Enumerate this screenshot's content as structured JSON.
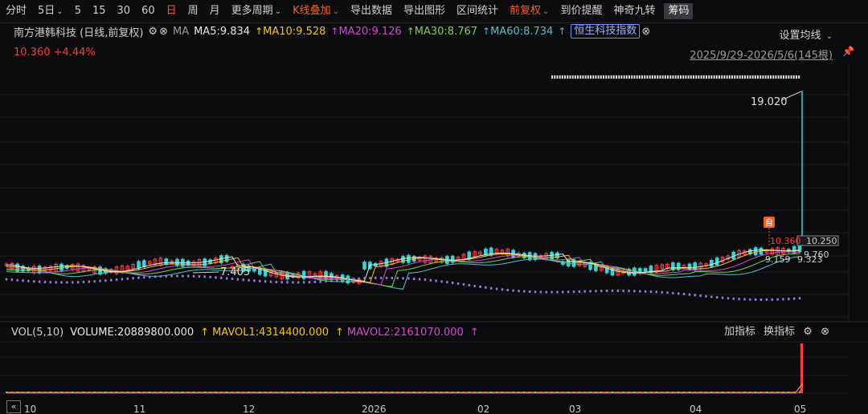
{
  "toolbar": {
    "items": [
      {
        "label": "分时"
      },
      {
        "label": "5日",
        "caret": true
      },
      {
        "label": "5"
      },
      {
        "label": "15"
      },
      {
        "label": "30"
      },
      {
        "label": "60"
      },
      {
        "label": "日",
        "active": true
      },
      {
        "label": "周"
      },
      {
        "label": "月"
      },
      {
        "label": "更多周期",
        "caret": true
      },
      {
        "label": "K线叠加",
        "active": true,
        "caret": true
      },
      {
        "label": "导出数据"
      },
      {
        "label": "导出图形"
      },
      {
        "label": "区间统计"
      },
      {
        "label": "前复权",
        "active": true,
        "caret": true
      },
      {
        "label": "到价提醒"
      },
      {
        "label": "神奇九转"
      },
      {
        "label": "筹码",
        "chip": true
      }
    ]
  },
  "info": {
    "title": "南方港韩科技 (日线,前复权)",
    "ma_label": "MA",
    "ma5": "MA5:9.834",
    "ma10": "MA10:9.528",
    "ma20": "MA20:9.126",
    "ma30": "MA30:8.767",
    "ma60": "MA60:8.734",
    "overlay_index": "恒生科技指数",
    "set_ma": "设置均线",
    "price_change": "10.360 +4.44%",
    "date_range": "2025/9/29-2026/5/6(145根)"
  },
  "colors": {
    "ma5": "#e6e6e6",
    "ma10": "#f5c518",
    "ma20": "#d14bd1",
    "ma30": "#7bd34a",
    "ma60": "#4fc3c8",
    "up": "#ff3a3a",
    "down": "#2fd6d6",
    "index": "#9a78e6",
    "accent": "#f0621e"
  },
  "chart_data": {
    "type": "candlestick",
    "price_annotations": [
      "19.020",
      "7.405"
    ],
    "right_labels": [
      "10.250",
      "10.360",
      "9.760",
      "9.323",
      "9.159"
    ],
    "x_labels": [
      "10",
      "11",
      "12",
      "2026",
      "02",
      "03",
      "04",
      "05"
    ],
    "marker": "自"
  },
  "volume": {
    "label": "VOL(5,10)",
    "volume": "VOLUME:20889800.000",
    "mavol1": "MAVOL1:4314400.000",
    "mavol2": "MAVOL2:2161070.000",
    "add_indicator": "加指标",
    "switch_indicator": "换指标"
  },
  "nav": {
    "collapse": "«"
  }
}
